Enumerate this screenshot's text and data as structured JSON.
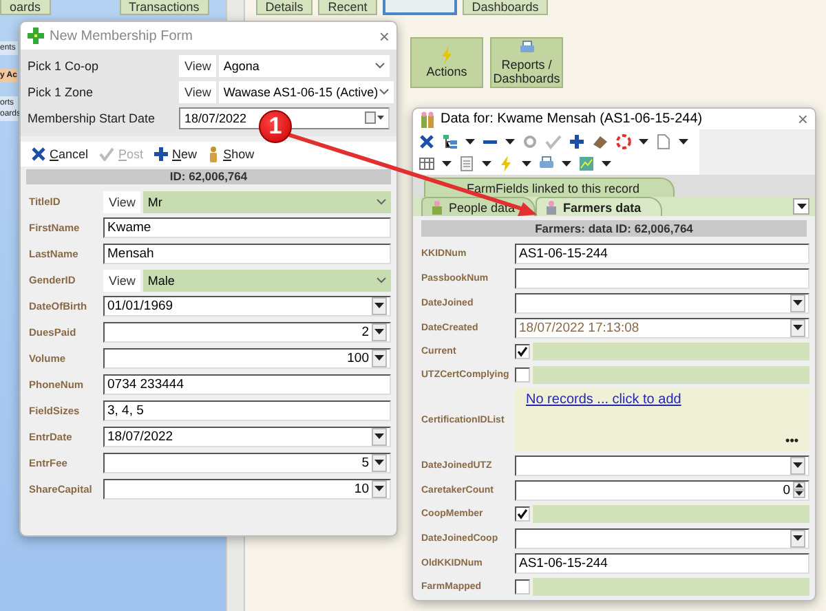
{
  "background": {
    "top_buttons": [
      {
        "label": "oards",
        "selected": false
      },
      {
        "label": "Transactions",
        "selected": false
      },
      {
        "label": "Details",
        "selected": false
      },
      {
        "label": "Recent",
        "selected": false
      },
      {
        "selected": true
      },
      {
        "label": "Dashboards",
        "selected": false
      }
    ],
    "sidebar": [
      {
        "lines": [
          "ents"
        ],
        "selected": false
      },
      {
        "lines": [
          "y Ac"
        ],
        "selected": true
      },
      {
        "lines": [
          "orts",
          "oards"
        ],
        "selected": false
      }
    ],
    "action_buttons": [
      {
        "label": "Actions",
        "kind": "actions"
      },
      {
        "label": "Reports / Dashboards",
        "kind": "reports"
      }
    ]
  },
  "membership_form": {
    "title": "New Membership Form",
    "close": "×",
    "pickers": [
      {
        "label": "Pick 1 Co-op",
        "kind": "lookup",
        "button": "View",
        "value": "Agona"
      },
      {
        "label": "Pick 1 Zone",
        "kind": "lookup",
        "button": "View",
        "value": "Wawase AS1-06-15 (Active)"
      },
      {
        "label": "Membership Start Date",
        "kind": "date",
        "value": "18/07/2022"
      }
    ],
    "toolbar": [
      {
        "label": "Cancel",
        "kind": "cancel",
        "disabled": false
      },
      {
        "label": "Post",
        "kind": "post",
        "disabled": true
      },
      {
        "label": "New",
        "kind": "new",
        "disabled": false
      },
      {
        "label": "Show",
        "kind": "show",
        "disabled": false
      }
    ],
    "id_bar": "ID: 62,006,764",
    "fields": [
      {
        "label": "TitleID",
        "kind": "lookup",
        "button": "View",
        "value": "Mr"
      },
      {
        "label": "FirstName",
        "kind": "text",
        "value": "Kwame"
      },
      {
        "label": "LastName",
        "kind": "text",
        "value": "Mensah"
      },
      {
        "label": "GenderID",
        "kind": "lookup",
        "button": "View",
        "value": "Male"
      },
      {
        "label": "DateOfBirth",
        "kind": "date",
        "value": "01/01/1969"
      },
      {
        "label": "DuesPaid",
        "kind": "number",
        "value": "2"
      },
      {
        "label": "Volume",
        "kind": "number",
        "value": "100"
      },
      {
        "label": "PhoneNum",
        "kind": "text",
        "value": "0734 233444"
      },
      {
        "label": "FieldSizes",
        "kind": "text",
        "value": "3, 4, 5"
      },
      {
        "label": "EntrDate",
        "kind": "date",
        "value": "18/07/2022"
      },
      {
        "label": "EntrFee",
        "kind": "number",
        "value": "5"
      },
      {
        "label": "ShareCapital",
        "kind": "number",
        "value": "10"
      }
    ]
  },
  "callout": {
    "label": "1"
  },
  "data_window": {
    "title": "Data for: Kwame Mensah  (AS1-06-15-244)",
    "close": "×",
    "upper_tabs": [
      {
        "label": "FarmFields linked to this record",
        "selected": false
      }
    ],
    "lower_tabs": [
      {
        "label": "People data",
        "selected": false
      },
      {
        "label": "Farmers data",
        "selected": true
      }
    ],
    "header": "Farmers: data ID: 62,006,764",
    "fields": [
      {
        "label": "KKIDNum",
        "kind": "text",
        "value": "AS1-06-15-244"
      },
      {
        "label": "PassbookNum",
        "kind": "text"
      },
      {
        "label": "DateJoined",
        "kind": "date"
      },
      {
        "label": "DateCreated",
        "kind": "date",
        "value": "18/07/2022 17:13:08",
        "read_only": true
      },
      {
        "label": "Current",
        "kind": "check",
        "checked": true
      },
      {
        "label": "UTZCertComplying",
        "kind": "check",
        "checked": false
      },
      {
        "label": "CertificationIDList",
        "kind": "sublist",
        "link": "No records ... click to add",
        "more": "•••"
      },
      {
        "label": "DateJoinedUTZ",
        "kind": "date"
      },
      {
        "label": "CaretakerCount",
        "kind": "spin",
        "value": "0"
      },
      {
        "label": "CoopMember",
        "kind": "check",
        "checked": true
      },
      {
        "label": "DateJoinedCoop",
        "kind": "date"
      },
      {
        "label": "OldKKIDNum",
        "kind": "text",
        "value": "AS1-06-15-244"
      },
      {
        "label": "FarmMapped",
        "kind": "check",
        "checked": false
      }
    ]
  }
}
